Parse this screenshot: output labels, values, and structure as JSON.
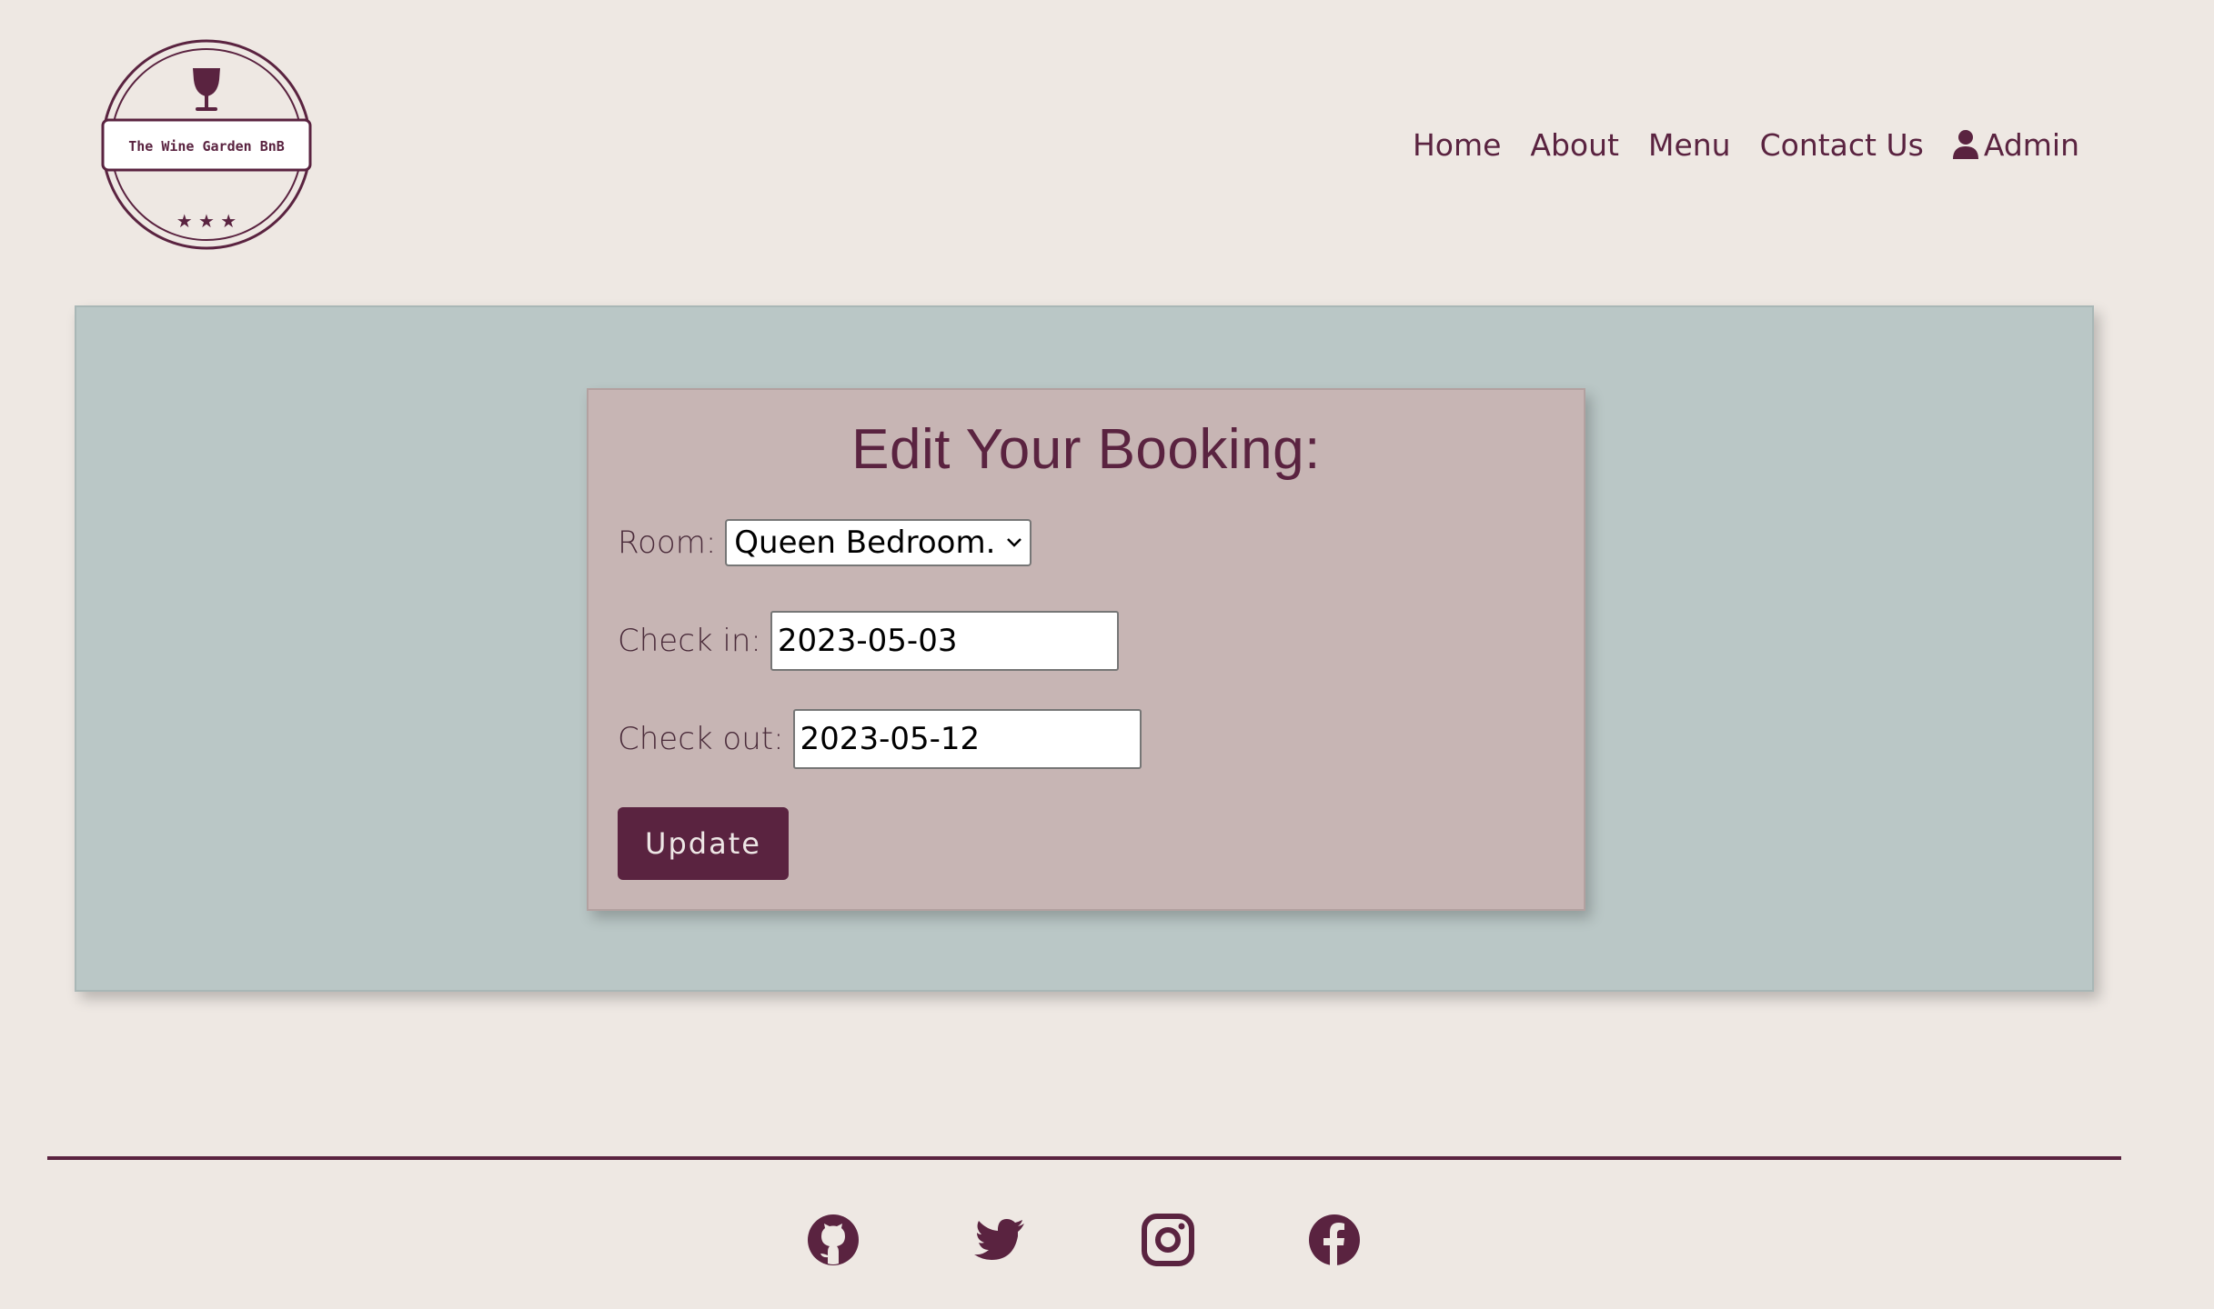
{
  "brand": {
    "logo_text": "The Wine Garden BnB",
    "logo_stars": "★ ★ ★"
  },
  "nav": {
    "items": [
      "Home",
      "About",
      "Menu",
      "Contact Us"
    ],
    "admin_label": "Admin"
  },
  "form": {
    "title": "Edit Your Booking:",
    "room_label": "Room:",
    "room_value": "Queen Bedroom.",
    "checkin_label": "Check in:",
    "checkin_value": "2023-05-03",
    "checkout_label": "Check out:",
    "checkout_value": "2023-05-12",
    "submit_label": "Update"
  },
  "footer": {
    "social_icons": [
      "github-icon",
      "twitter-icon",
      "instagram-icon",
      "facebook-icon"
    ]
  },
  "colors": {
    "background": "#EEE8E3",
    "accent": "#5A2340",
    "panel": "#BAC7C6",
    "card": "#C7B5B4"
  }
}
